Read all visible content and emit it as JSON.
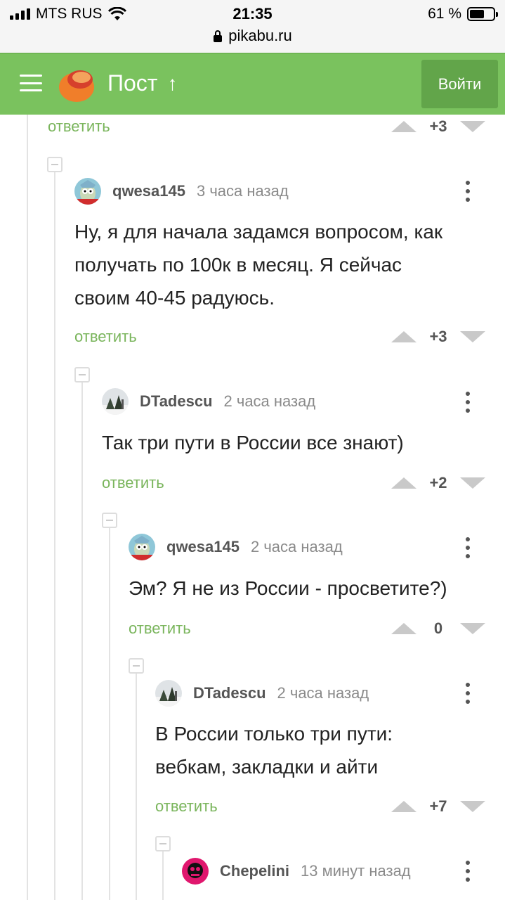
{
  "status_bar": {
    "carrier": "MTS RUS",
    "time": "21:35",
    "battery": "61 %",
    "url": "pikabu.ru"
  },
  "header": {
    "title": "Пост",
    "up_arrow": "↑",
    "login_label": "Войти"
  },
  "top_fragment": {
    "reply_label": "ответить",
    "score": "+3"
  },
  "comments": [
    {
      "author": "qwesa145",
      "time": "3 часа назад",
      "lines": [
        "Ну, я для начала задамся вопросом, как",
        "получать по 100к в месяц. Я сейчас",
        "своим 40-45 радуюсь."
      ],
      "reply_label": "ответить",
      "score": "+3",
      "avatar": "rick-avatar"
    },
    {
      "author": "DTadescu",
      "time": "2 часа назад",
      "lines": [
        "Так три пути в России все знают)"
      ],
      "reply_label": "ответить",
      "score": "+2",
      "avatar": "winter-photo-avatar"
    },
    {
      "author": "qwesa145",
      "time": "2 часа назад",
      "lines": [
        "Эм? Я не из России - просветите?)"
      ],
      "reply_label": "ответить",
      "score": "0",
      "avatar": "rick-avatar"
    },
    {
      "author": "DTadescu",
      "time": "2 часа назад",
      "lines": [
        "В России только три пути:",
        "вебкам, закладки и айти"
      ],
      "reply_label": "ответить",
      "score": "+7",
      "avatar": "winter-photo-avatar"
    },
    {
      "author": "Chepelini",
      "time": "13 минут назад",
      "lines": [],
      "reply_label": "",
      "score": "",
      "avatar": "pink-avatar"
    }
  ],
  "colors": {
    "accent": "#7ac25e",
    "reply": "#7ab55c",
    "login_button": "#62a54a"
  }
}
